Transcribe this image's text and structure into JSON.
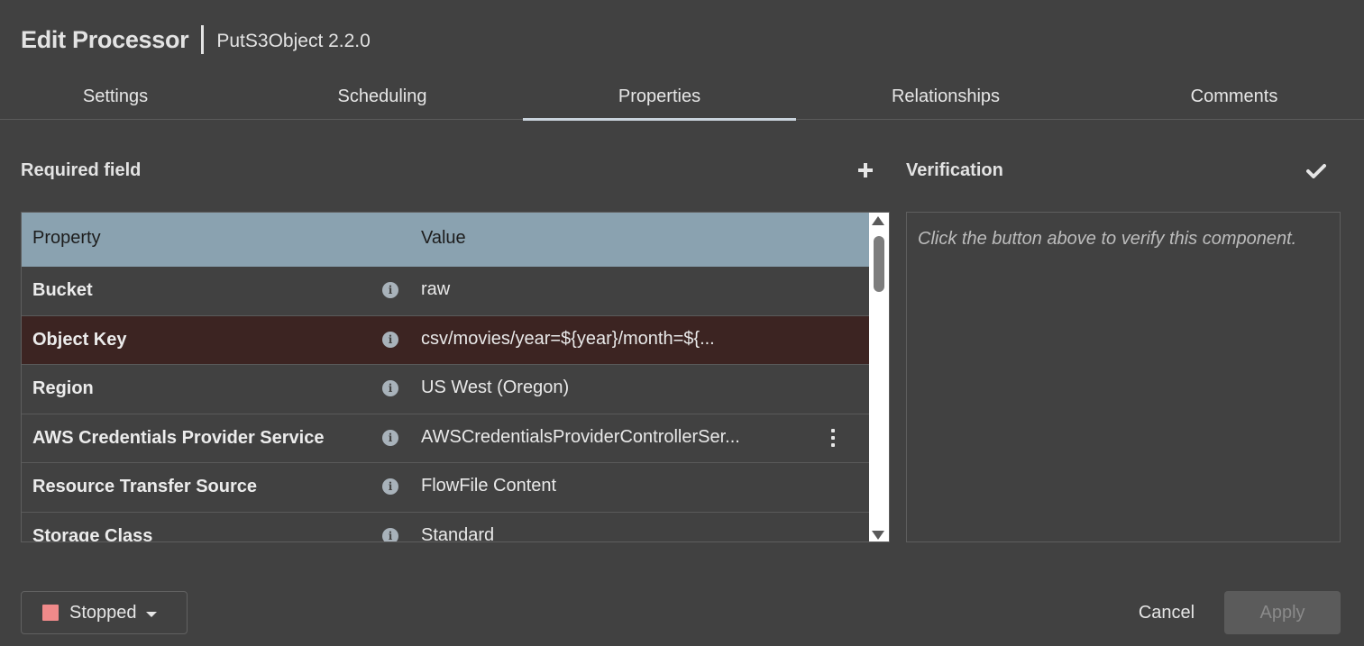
{
  "dialog": {
    "title": "Edit Processor",
    "subtitle": "PutS3Object 2.2.0"
  },
  "tabs": [
    {
      "label": "Settings"
    },
    {
      "label": "Scheduling"
    },
    {
      "label": "Properties",
      "active": true
    },
    {
      "label": "Relationships"
    },
    {
      "label": "Comments"
    }
  ],
  "properties": {
    "section_label": "Required field",
    "columns": {
      "property": "Property",
      "value": "Value"
    },
    "rows": [
      {
        "name": "Bucket",
        "value": "raw"
      },
      {
        "name": "Object Key",
        "value": "csv/movies/year=${year}/month=${..."
      },
      {
        "name": "Region",
        "value": "US West (Oregon)"
      },
      {
        "name": "AWS Credentials Provider Service",
        "value": "AWSCredentialsProviderControllerSer..."
      },
      {
        "name": "Resource Transfer Source",
        "value": "FlowFile Content"
      },
      {
        "name": "Storage Class",
        "value": "Standard"
      }
    ]
  },
  "verification": {
    "label": "Verification",
    "message": "Click the button above to verify this component."
  },
  "footer": {
    "status_label": "Stopped",
    "cancel_label": "Cancel",
    "apply_label": "Apply"
  },
  "colors": {
    "stopped_indicator": "#f08a8a",
    "selected_row": "#3c2422",
    "header_row": "#8aa2b0"
  }
}
